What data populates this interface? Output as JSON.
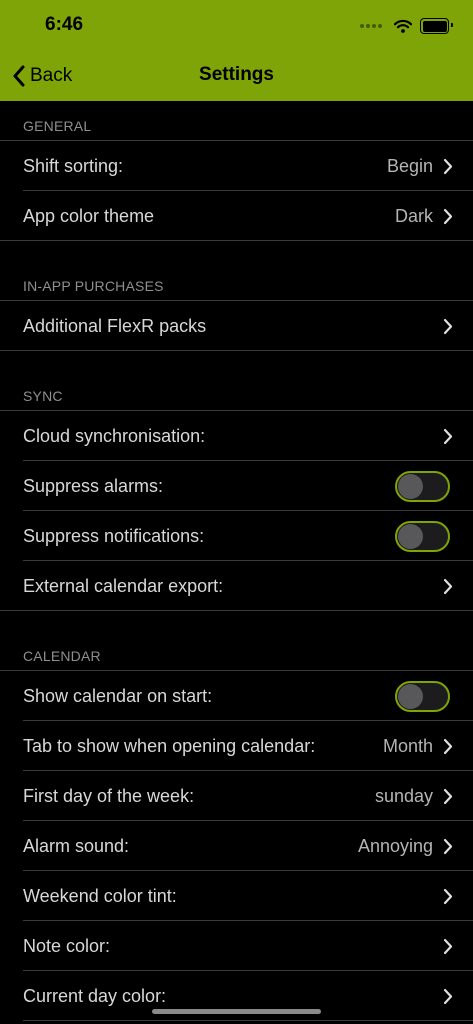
{
  "status_bar": {
    "time": "6:46",
    "signal_icon": "signal-bars-icon",
    "wifi_icon": "wifi-icon",
    "battery_icon": "battery-icon"
  },
  "nav": {
    "back_label": "Back",
    "back_icon": "chevron-left-icon",
    "title": "Settings"
  },
  "colors": {
    "accent": "#7ea407",
    "background": "#000000",
    "separator": "#3a3a3c",
    "section_header": "#8e8e93"
  },
  "sections": {
    "general": {
      "header": "GENERAL",
      "shift_sorting": {
        "label": "Shift sorting:",
        "value": "Begin"
      },
      "app_color_theme": {
        "label": "App color theme",
        "value": "Dark"
      }
    },
    "purchases": {
      "header": "IN-APP PURCHASES",
      "flexr_packs": {
        "label": "Additional FlexR packs"
      }
    },
    "sync": {
      "header": "SYNC",
      "cloud_sync": {
        "label": "Cloud synchronisation:"
      },
      "suppress_alarms": {
        "label": "Suppress alarms:",
        "on": false
      },
      "suppress_notifications": {
        "label": "Suppress notifications:",
        "on": false
      },
      "calendar_export": {
        "label": "External calendar export:"
      }
    },
    "calendar": {
      "header": "CALENDAR",
      "show_on_start": {
        "label": "Show calendar on start:",
        "on": false
      },
      "tab_on_open": {
        "label": "Tab to show when opening calendar:",
        "value": "Month"
      },
      "first_day": {
        "label": "First day of the week:",
        "value": "sunday"
      },
      "alarm_sound": {
        "label": "Alarm sound:",
        "value": "Annoying"
      },
      "weekend_tint": {
        "label": "Weekend color tint:"
      },
      "note_color": {
        "label": "Note color:"
      },
      "current_day_color": {
        "label": "Current day color:"
      }
    }
  }
}
